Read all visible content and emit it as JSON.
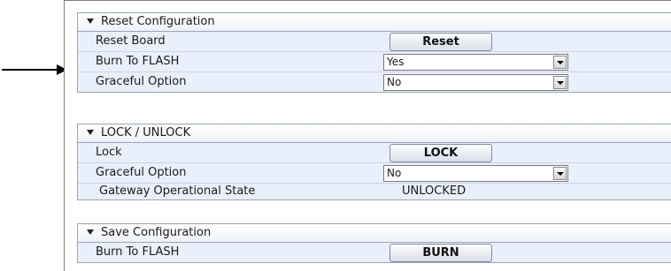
{
  "sections": [
    {
      "title": "Reset Configuration",
      "rows": [
        {
          "label": "Reset Board",
          "button": "Reset"
        },
        {
          "label": "Burn To FLASH",
          "select": "Yes"
        },
        {
          "label": "Graceful Option",
          "select": "No"
        }
      ]
    },
    {
      "title": "LOCK / UNLOCK",
      "rows": [
        {
          "label": "Lock",
          "button": "LOCK"
        },
        {
          "label": "Graceful Option",
          "select": "No"
        },
        {
          "label": "Gateway Operational State",
          "value": "UNLOCKED"
        }
      ]
    },
    {
      "title": "Save Configuration",
      "rows": [
        {
          "label": "Burn To FLASH",
          "button": "BURN"
        }
      ]
    }
  ]
}
